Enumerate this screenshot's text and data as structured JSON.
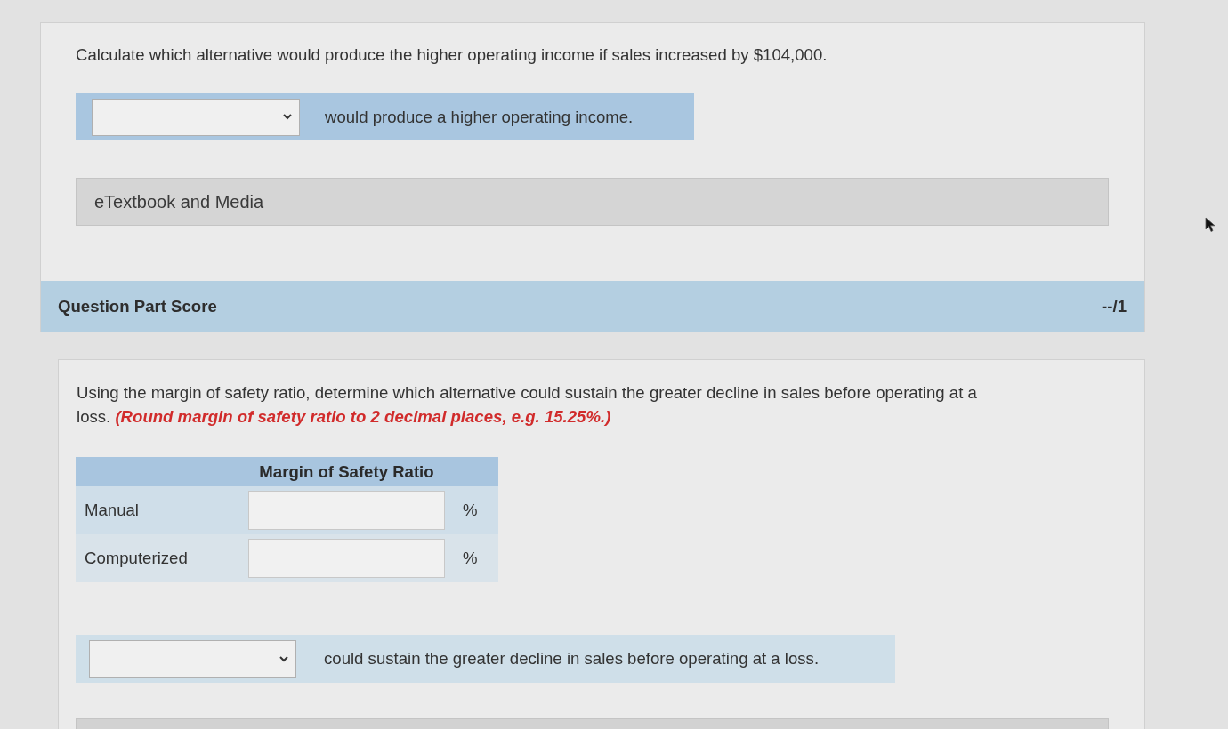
{
  "question_1": {
    "prompt": "Calculate which alternative would produce the higher operating income if sales increased by $104,000.",
    "answer": {
      "suffix": "would produce a higher operating income."
    }
  },
  "resources": {
    "label": "eTextbook and Media"
  },
  "score": {
    "label": "Question Part Score",
    "value": "--/1"
  },
  "question_2": {
    "prompt": "Using the margin of safety ratio, determine which alternative could sustain the greater decline in sales before operating at a loss.",
    "note": "(Round margin of safety ratio to 2 decimal places, e.g. 15.25%.)",
    "table": {
      "columns": [
        "Margin of Safety Ratio"
      ],
      "rows": [
        {
          "label": "Manual",
          "unit": "%"
        },
        {
          "label": "Computerized",
          "unit": "%"
        }
      ]
    },
    "answer": {
      "suffix": "could sustain the greater decline in sales before operating at a loss."
    }
  }
}
